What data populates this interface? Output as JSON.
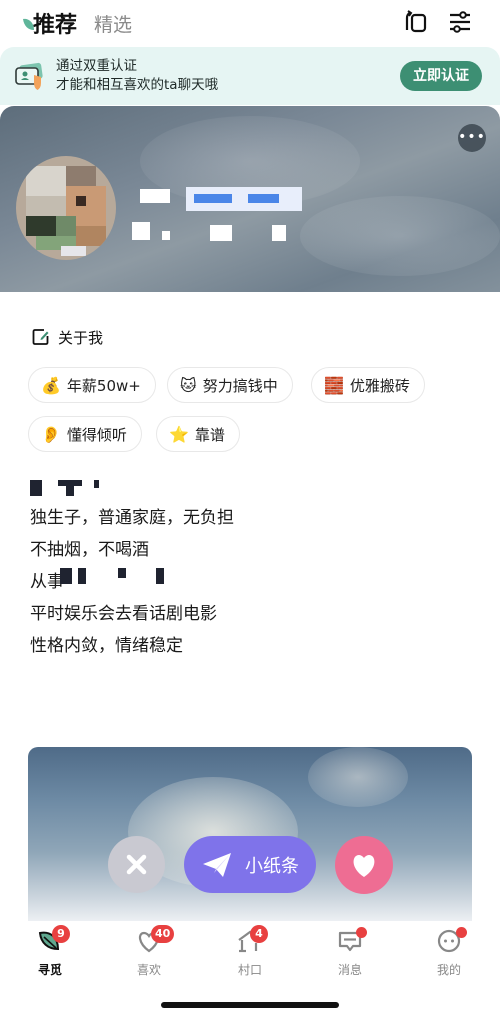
{
  "header": {
    "tabs": [
      {
        "label": "推荐",
        "active": true
      },
      {
        "label": "精选",
        "active": false
      }
    ],
    "icons": [
      "swap-icon",
      "filter-icon"
    ]
  },
  "verify_banner": {
    "line1": "通过双重认证",
    "line2": "才能和相互喜欢的ta聊天哦",
    "button_label": "立即认证",
    "accent": "#3d8f73"
  },
  "profile": {
    "more_label": "•••",
    "about_title": "关于我",
    "tags": [
      {
        "emoji": "💰",
        "label": "年薪50w+"
      },
      {
        "emoji": "🐱",
        "label": "努力搞钱中"
      },
      {
        "emoji": "🧱",
        "label": "优雅搬砖"
      },
      {
        "emoji": "👂",
        "label": "懂得倾听"
      },
      {
        "emoji": "⭐",
        "label": "靠谱"
      }
    ],
    "bio_lines": [
      "独生子，普通家庭，无负担",
      "不抽烟，不喝酒",
      "从事",
      "平时娱乐会去看话剧电影",
      "性格内敛，情绪稳定"
    ]
  },
  "actions": {
    "pass_label": "✕",
    "note_label": "小纸条",
    "like_label": "♥",
    "note_color": "#7f73ea",
    "like_color": "#ee6d93"
  },
  "nav": {
    "items": [
      {
        "label": "寻觅",
        "badge": "9",
        "active": true
      },
      {
        "label": "喜欢",
        "badge": "40",
        "active": false
      },
      {
        "label": "村口",
        "badge": "4",
        "active": false
      },
      {
        "label": "消息",
        "badge": "",
        "dot": true,
        "active": false
      },
      {
        "label": "我的",
        "badge": "",
        "dot": true,
        "active": false
      }
    ],
    "badge_color": "#e84040"
  }
}
